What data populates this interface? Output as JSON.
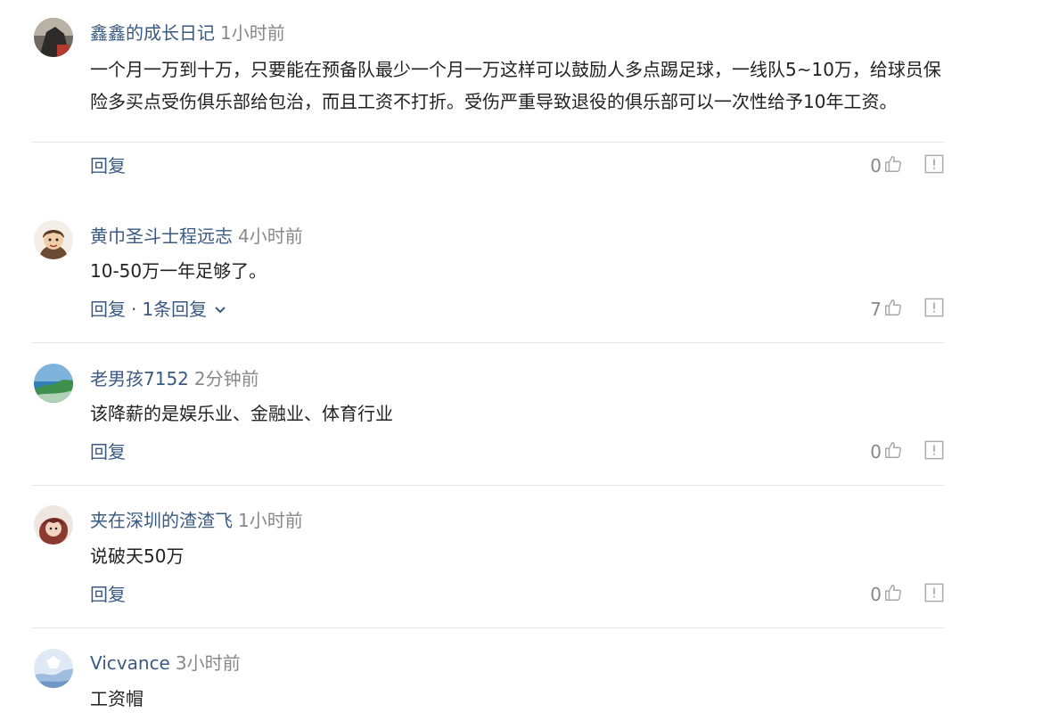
{
  "comments": [
    {
      "username": "鑫鑫的成长日记",
      "time": "1小时前",
      "text": "一个月一万到十万，只要能在预备队最少一个月一万这样可以鼓励人多点踢足球，一线队5~10万，给球员保险多买点受伤俱乐部给包治，而且工资不打折。受伤严重导致退役的俱乐部可以一次性给予10年工资。",
      "reply_label": "回复",
      "likes": "0"
    },
    {
      "username": "黄巾圣斗士程远志",
      "time": "4小时前",
      "text": "10-50万一年足够了。",
      "reply_label": "回复",
      "sep": "·",
      "reply_count": "1条回复",
      "likes": "7"
    },
    {
      "username": "老男孩7152",
      "time": "2分钟前",
      "text": "该降薪的是娱乐业、金融业、体育行业",
      "reply_label": "回复",
      "likes": "0"
    },
    {
      "username": "夹在深圳的渣渣飞",
      "time": "1小时前",
      "text": "说破天50万",
      "reply_label": "回复",
      "likes": "0"
    },
    {
      "username": "Vicvance",
      "time": "3小时前",
      "text": "工资帽"
    }
  ],
  "icons": {
    "like": "thumbs-up-icon",
    "report": "report-icon",
    "chevron": "chevron-down-icon"
  },
  "colors": {
    "username": "#3b5a82",
    "time": "#888888",
    "text": "#222222",
    "divider": "#e5e5e5"
  }
}
